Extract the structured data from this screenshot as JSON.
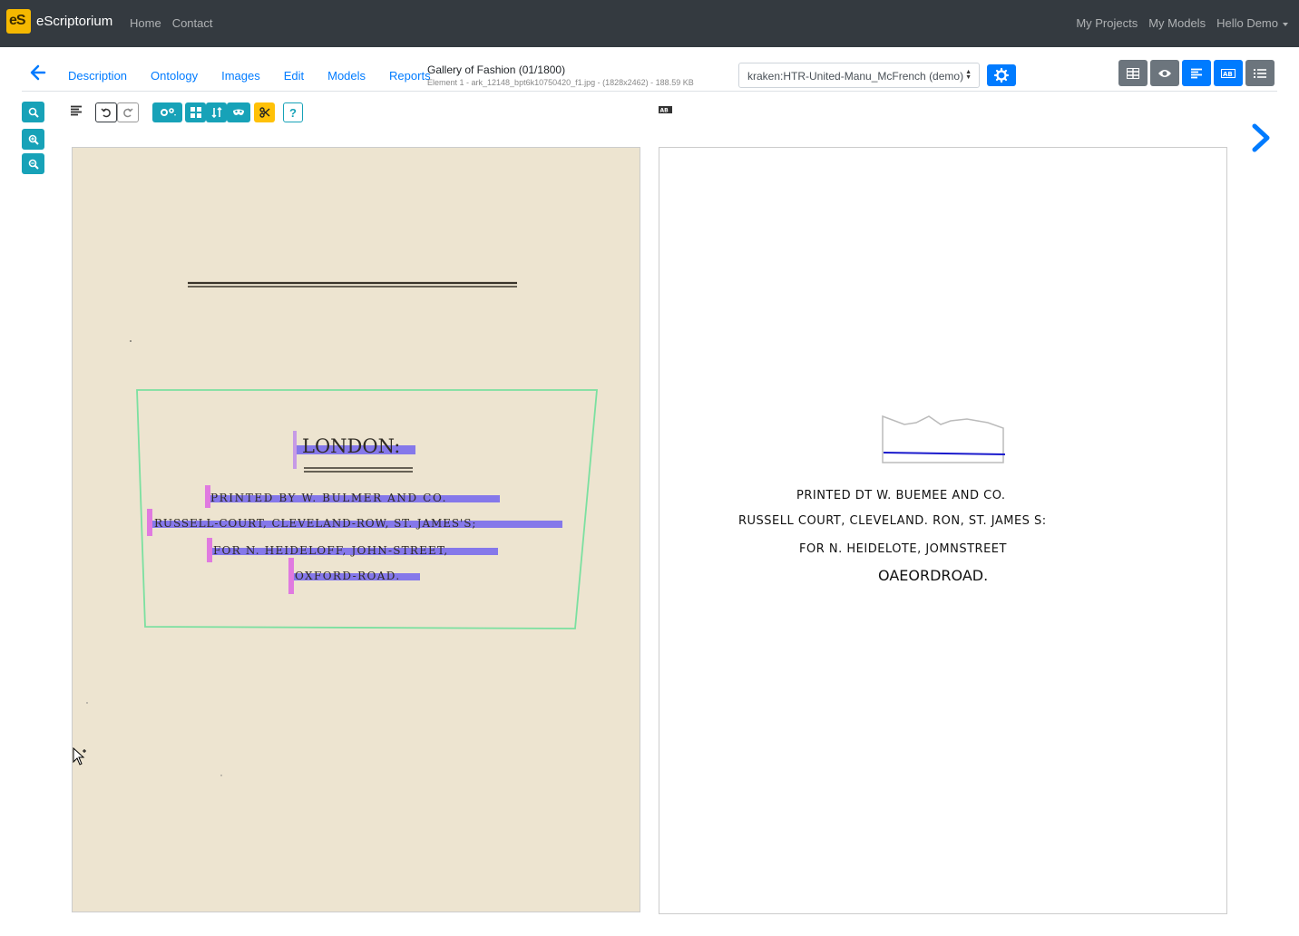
{
  "app": {
    "name": "eScriptorium",
    "logo_text": "eS"
  },
  "navbar": {
    "left_links": [
      "Home",
      "Contact"
    ],
    "right_links": [
      "My Projects",
      "My Models"
    ],
    "user_menu": "Hello Demo"
  },
  "document": {
    "tabs": [
      "Description",
      "Ontology",
      "Images",
      "Edit",
      "Models",
      "Reports"
    ],
    "title": "Gallery of Fashion (01/1800)",
    "subtitle": "Element 1 - ark_12148_bpt6k10750420_f1.jpg - (1828x2462) - 188.59 KB"
  },
  "model_select": {
    "value": "kraken:HTR-United-Manu_McFrench (demo)"
  },
  "colors": {
    "navbar": "#343a40",
    "primary": "#007bff",
    "info": "#17a2b8",
    "warning": "#ffc107",
    "secondary": "#6c757d",
    "region_outline": "#7be0a0",
    "line_mask": "#6a5cf0",
    "line_start": "#e07ae0"
  },
  "icons": [
    "back-arrow-icon",
    "zoom-reset-icon",
    "zoom-in-icon",
    "zoom-out-icon",
    "align-left-icon",
    "undo-icon",
    "redo-icon",
    "settings-icon",
    "grid-icon",
    "sort-icon",
    "mask-icon",
    "scissors-icon",
    "help-icon",
    "gear-icon",
    "eye-icon",
    "list-icon",
    "chevron-right-icon",
    "cursor-icon"
  ],
  "toolbar": {
    "help_label": "?"
  },
  "page_image": {
    "lines": [
      "LONDON:",
      "PRINTED BY W. BULMER AND CO.",
      "RUSSELL-COURT, CLEVELAND-ROW, ST. JAMES'S;",
      "FOR N. HEIDELOFF, JOHN-STREET,",
      "OXFORD-ROAD."
    ]
  },
  "transcription": {
    "lines": [
      "PRINTED DT W. BUEMEE AND CO.",
      "RUSSELL COURT, CLEVELAND. RON, ST. JAMES S:",
      "FOR N. HEIDELOTE, JOMNSTREET",
      "OAEORDROAD."
    ]
  }
}
